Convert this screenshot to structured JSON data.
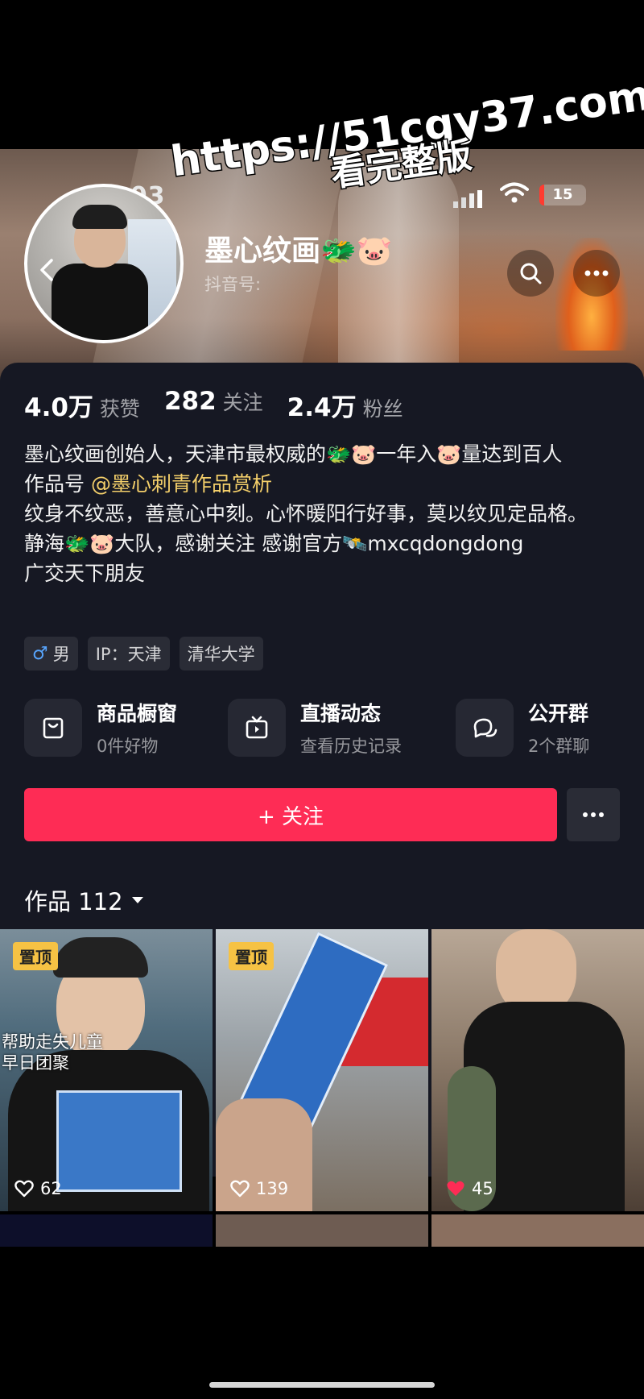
{
  "watermark": {
    "url": "https://51cgy37.com",
    "text": "看完整版"
  },
  "status_bar": {
    "time": "08:03",
    "battery": "15"
  },
  "profile": {
    "name": "墨心纹画",
    "emoji": "🐲🐷",
    "id_label": "抖音号:"
  },
  "stats": [
    {
      "value": "4.0万",
      "label": "获赞"
    },
    {
      "value": "282",
      "label": "关注"
    },
    {
      "value": "2.4万",
      "label": "粉丝"
    }
  ],
  "bio": {
    "line1": "墨心纹画创始人，天津市最权威的🐲🐷一年入🐷量达到百人",
    "line2_prefix": "作品号",
    "line2_link": "@墨心刺青作品赏析",
    "line3": "纹身不纹恶，善意心中刻。心怀暖阳行好事，莫以纹见定品格。",
    "line4": "静海🐲🐷大队，感谢关注 感谢官方🛰️mxcqdongdong",
    "line5": "广交天下朋友"
  },
  "tags": {
    "gender": "男",
    "ip": "IP：天津",
    "school": "清华大学"
  },
  "features": [
    {
      "title": "商品橱窗",
      "subtitle": "0件好物",
      "icon": "shopping-bag-icon"
    },
    {
      "title": "直播动态",
      "subtitle": "查看历史记录",
      "icon": "tv-icon"
    },
    {
      "title": "公开群",
      "subtitle": "2个群聊",
      "icon": "chat-group-icon"
    }
  ],
  "actions": {
    "follow": "+ 关注"
  },
  "works": {
    "label": "作品 112",
    "items": [
      {
        "pinned": "置顶",
        "likes": "62",
        "overlay": "帮助走失儿童\n早日团聚",
        "liked": false
      },
      {
        "pinned": "置顶",
        "likes": "139",
        "overlay": "",
        "liked": false
      },
      {
        "pinned": "",
        "likes": "45",
        "overlay": "",
        "liked": true
      }
    ]
  },
  "colors": {
    "accent": "#fe2c55",
    "link": "#f4cf6a",
    "pin": "#f6c244",
    "panel": "#161823"
  }
}
